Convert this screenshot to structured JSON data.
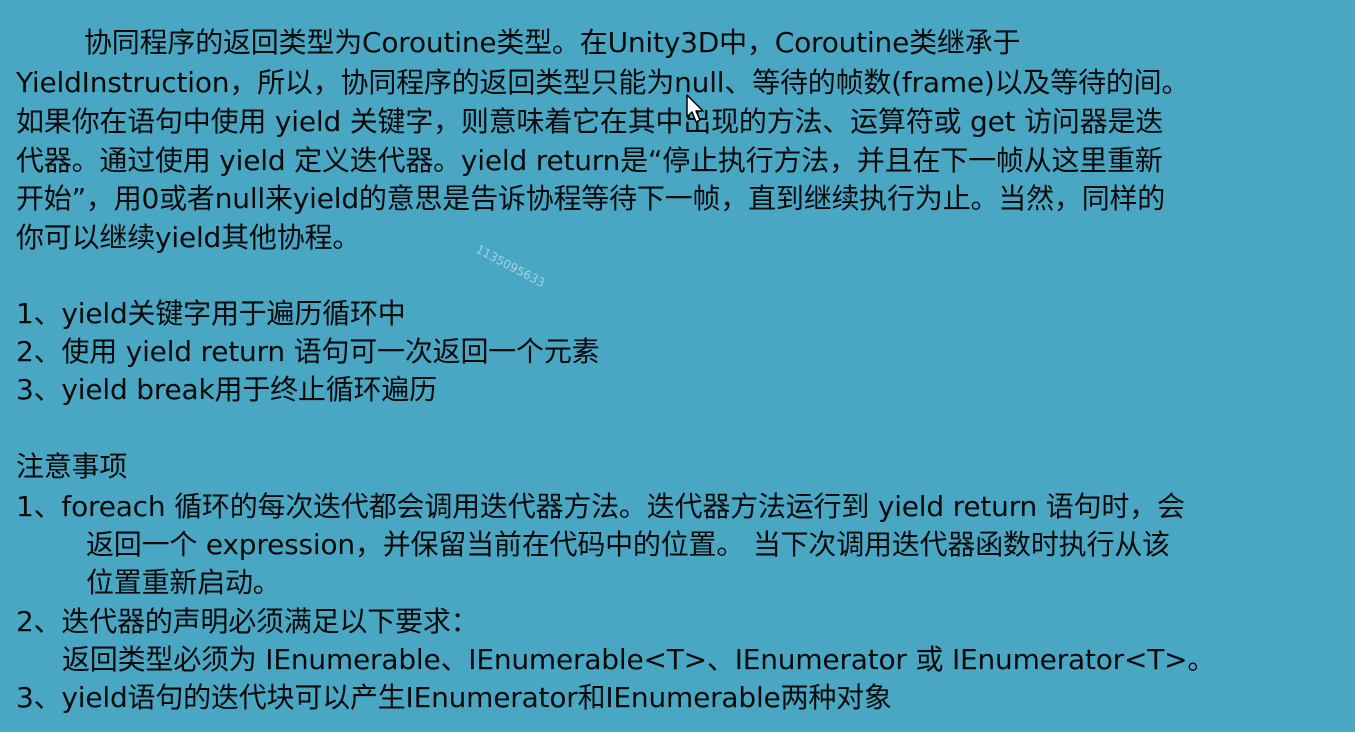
{
  "paragraph": [
    "协同程序的返回类型为Coroutine类型。在Unity3D中，Coroutine类继承于",
    "YieldInstruction，所以，协同程序的返回类型只能为null、等待的帧数(frame)以及等待的间。",
    "如果你在语句中使用 yield 关键字，则意味着它在其中出现的方法、运算符或 get 访问器是迭",
    "代器。通过使用 yield 定义迭代器。yield return是“停止执行方法，并且在下一帧从这里重新",
    "开始”，用0或者null来yield的意思是告诉协程等待下一帧，直到继续执行为止。当然，同样的",
    "你可以继续yield其他协程。"
  ],
  "list1": [
    "1、yield关键字用于遍历循环中",
    "2、使用 yield return 语句可一次返回一个元素",
    "3、yield break用于终止循环遍历"
  ],
  "notes": {
    "heading": "注意事项",
    "item1": [
      "1、foreach 循环的每次迭代都会调用迭代器方法。迭代器方法运行到 yield return 语句时，会",
      "返回一个 expression，并保留当前在代码中的位置。 当下次调用迭代器函数时执行从该",
      "位置重新启动。"
    ],
    "item2": [
      "2、迭代器的声明必须满足以下要求：",
      "返回类型必须为 IEnumerable、IEnumerable<T>、IEnumerator 或 IEnumerator<T>。"
    ],
    "item3": "3、yield语句的迭代块可以产生IEnumerator和IEnumerable两种对象"
  },
  "watermark": "1135095633",
  "icons": {
    "cursor": "mouse-pointer-icon"
  },
  "colors": {
    "background": "#4aa7c4",
    "text": "#0a0a0a"
  }
}
